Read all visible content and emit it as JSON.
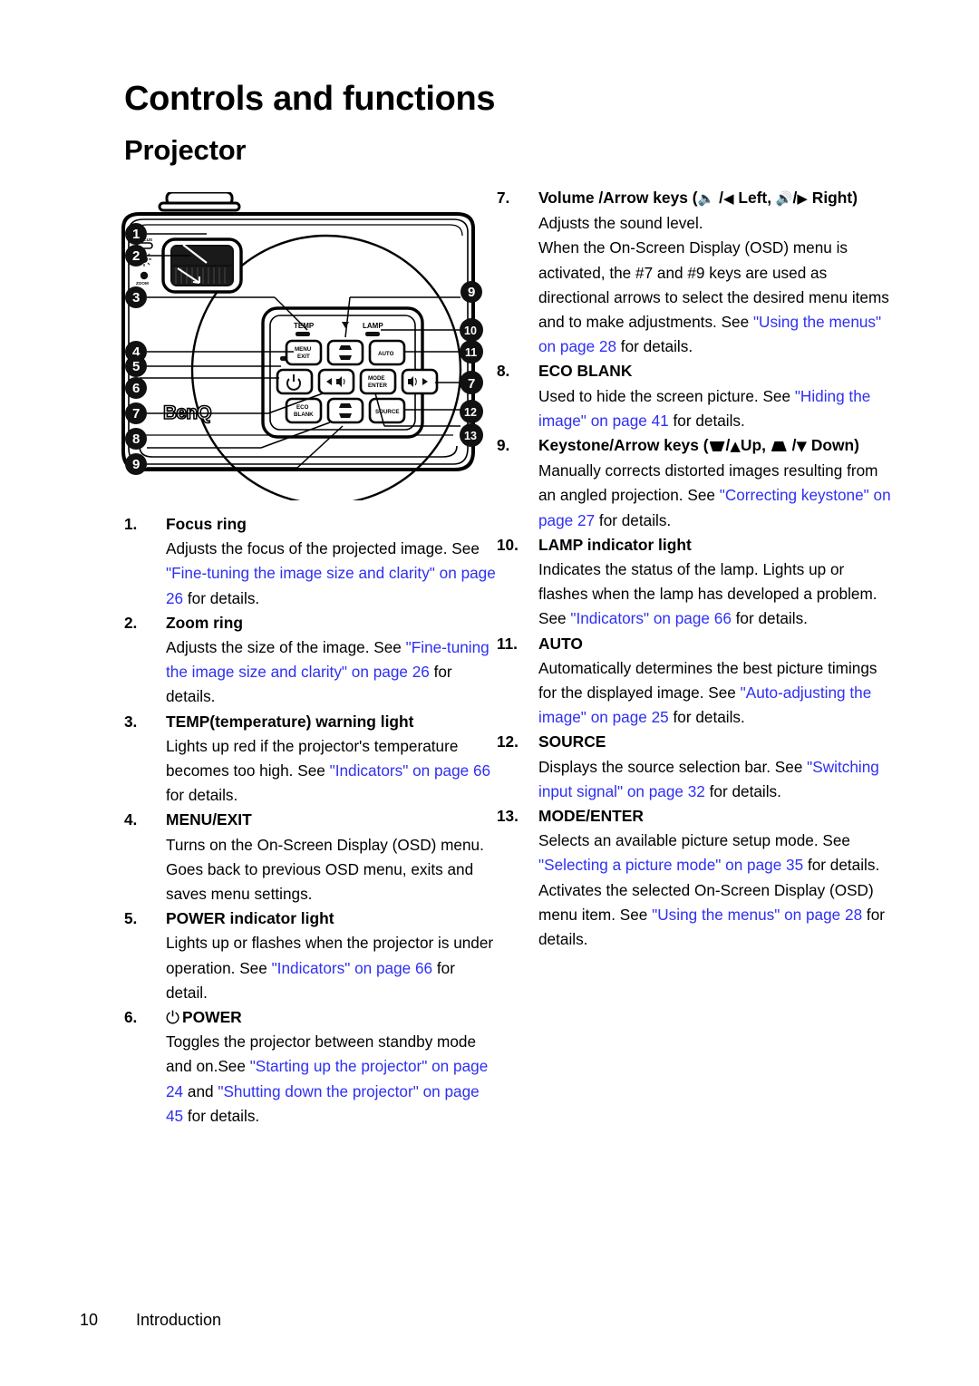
{
  "document": {
    "h1": "Controls and functions",
    "h2": "Projector"
  },
  "footer": {
    "page_number": "10",
    "section": "Introduction"
  },
  "figure": {
    "name": "projector-top-view-diagram",
    "brand_logo": "BenQ",
    "lens_labels": {
      "focus": "FOCUS",
      "zoom": "ZOOM"
    },
    "panel_indicator_labels": {
      "temp": "TEMP",
      "lamp": "LAMP"
    },
    "buttons": [
      {
        "id": "menu-exit",
        "line1": "MENU",
        "line2": "EXIT"
      },
      {
        "id": "keystone-up",
        "line1": "",
        "line2": ""
      },
      {
        "id": "auto",
        "line1": "AUTO",
        "line2": ""
      },
      {
        "id": "power",
        "line1": "",
        "line2": ""
      },
      {
        "id": "volume-left",
        "line1": "",
        "line2": ""
      },
      {
        "id": "mode-enter",
        "line1": "MODE",
        "line2": "ENTER"
      },
      {
        "id": "volume-right",
        "line1": "",
        "line2": ""
      },
      {
        "id": "eco-blank",
        "line1": "ECO",
        "line2": "BLANK"
      },
      {
        "id": "keystone-down",
        "line1": "",
        "line2": ""
      },
      {
        "id": "source",
        "line1": "SOURCE",
        "line2": ""
      }
    ],
    "callouts_left": [
      "1",
      "2",
      "3",
      "4",
      "5",
      "6",
      "7",
      "8",
      "9"
    ],
    "callouts_right": [
      "9",
      "10",
      "11",
      "7",
      "12",
      "13"
    ]
  },
  "left_column": [
    {
      "number": "1.",
      "term": "Focus ring",
      "lines": [
        [
          {
            "t": "Adjusts the focus of the projected image. ",
            "link": false
          },
          {
            "t": "See ",
            "link": false
          },
          {
            "t": "\"Fine-tuning the image size and clarity\" on page 26",
            "link": true
          },
          {
            "t": " for details.",
            "link": false
          }
        ]
      ]
    },
    {
      "number": "2.",
      "term": "Zoom ring",
      "lines": [
        [
          {
            "t": "Adjusts the size of the image. See ",
            "link": false
          },
          {
            "t": "\"Fine-tuning the image size and clarity\" on page 26",
            "link": true
          },
          {
            "t": " for details.",
            "link": false
          }
        ]
      ]
    },
    {
      "number": "3.",
      "term": "TEMP(temperature) warning light",
      "lines": [
        [
          {
            "t": "Lights up red if the projector's temperature becomes too high. See ",
            "link": false
          },
          {
            "t": "\"Indicators\" on page 66",
            "link": true
          },
          {
            "t": " for details.",
            "link": false
          }
        ]
      ]
    },
    {
      "number": "4.",
      "term": "MENU/EXIT",
      "lines": [
        [
          {
            "t": "Turns on the On-Screen Display (OSD) menu. Goes back to previous OSD menu, exits and saves menu settings.",
            "link": false
          }
        ]
      ]
    },
    {
      "number": "5.",
      "term": "POWER indicator light",
      "lines": [
        [
          {
            "t": "Lights up or flashes when the projector is under operation. See ",
            "link": false
          },
          {
            "t": "\"Indicators\" on page 66",
            "link": true
          },
          {
            "t": " for detail.",
            "link": false
          }
        ]
      ]
    },
    {
      "number": "6.",
      "term": "POWER",
      "term_glyph": "⏻",
      "lines": [
        [
          {
            "t": "Toggles the projector between standby mode and on.See ",
            "link": false
          },
          {
            "t": "\"Starting up the projector\" on page 24",
            "link": true
          },
          {
            "t": " and ",
            "link": false
          },
          {
            "t": "\"Shutting down the projector\" on page 45",
            "link": true
          },
          {
            "t": " for details.",
            "link": false
          }
        ]
      ]
    }
  ],
  "right_column": [
    {
      "number": "7.",
      "term_parts": [
        {
          "t": "Volume /Arrow keys (",
          "kind": "text"
        },
        {
          "t": "speaker-low-icon",
          "kind": "glyph",
          "ch": "🔈"
        },
        {
          "t": " /",
          "kind": "text"
        },
        {
          "t": "left-arrow-icon",
          "kind": "glyph",
          "ch": "◀"
        },
        {
          "t": "  Left, ",
          "kind": "text"
        },
        {
          "t": "speaker-high-icon",
          "kind": "glyph",
          "ch": "🔊"
        },
        {
          "t": "/",
          "kind": "text"
        },
        {
          "t": "right-arrow-icon",
          "kind": "glyph",
          "ch": "▶"
        },
        {
          "t": "  Right)",
          "kind": "text"
        }
      ],
      "term_plain": "Volume /Arrow keys ( / Left, / Right)",
      "lines": [
        [
          {
            "t": "Adjusts the sound level.",
            "link": false
          }
        ],
        [
          {
            "t": "When the On-Screen Display (OSD) menu is activated, the #7 and #9 keys are used as directional arrows to select the desired menu items and to make adjustments. See ",
            "link": false
          },
          {
            "t": "\"Using the menus\" on page 28",
            "link": true
          },
          {
            "t": " for details.",
            "link": false
          }
        ]
      ]
    },
    {
      "number": "8.",
      "term": "ECO BLANK",
      "lines": [
        [
          {
            "t": "Used to hide the screen picture. See ",
            "link": false
          },
          {
            "t": "\"Hiding the image\" on page 41",
            "link": true
          },
          {
            "t": " for details.",
            "link": false
          }
        ]
      ]
    },
    {
      "number": "9.",
      "term_parts": [
        {
          "t": "Keystone/Arrow keys (",
          "kind": "text"
        },
        {
          "t": "keystone-down-icon",
          "kind": "keystone",
          "dir": "down"
        },
        {
          "t": "/",
          "kind": "text"
        },
        {
          "t": "up-arrow-icon",
          "kind": "glyph",
          "ch": "▲"
        },
        {
          "t": "Up, ",
          "kind": "text"
        },
        {
          "t": "keystone-up-icon",
          "kind": "keystone",
          "dir": "up"
        },
        {
          "t": " /",
          "kind": "text"
        },
        {
          "t": "down-arrow-icon",
          "kind": "glyph",
          "ch": "▼"
        },
        {
          "t": " Down)",
          "kind": "text"
        }
      ],
      "term_plain": "Keystone/Arrow keys ( /Up, / Down)",
      "lines": [
        [
          {
            "t": "Manually corrects distorted images resulting from an angled projection. See ",
            "link": false
          },
          {
            "t": "\"Correcting keystone\" on page 27",
            "link": true
          },
          {
            "t": " for details.",
            "link": false
          }
        ]
      ]
    },
    {
      "number": "10.",
      "term": "LAMP indicator light",
      "lines": [
        [
          {
            "t": "Indicates the status of the lamp. Lights up or flashes when the lamp has developed a problem. See ",
            "link": false
          },
          {
            "t": "\"Indicators\" on page 66",
            "link": true
          },
          {
            "t": " for details.",
            "link": false
          }
        ]
      ]
    },
    {
      "number": "11.",
      "term": "AUTO",
      "lines": [
        [
          {
            "t": "Automatically determines the best picture timings for the displayed image. See ",
            "link": false
          },
          {
            "t": "\"Auto-adjusting the image\" on page 25",
            "link": true
          },
          {
            "t": " for details.",
            "link": false
          }
        ]
      ]
    },
    {
      "number": "12.",
      "term": "SOURCE",
      "lines": [
        [
          {
            "t": "Displays the source selection bar. See ",
            "link": false
          },
          {
            "t": "\"Switching input signal\" on page 32",
            "link": true
          },
          {
            "t": " for details.",
            "link": false
          }
        ]
      ]
    },
    {
      "number": "13.",
      "term": "MODE/ENTER",
      "lines": [
        [
          {
            "t": "Selects an available picture setup mode. See ",
            "link": false
          },
          {
            "t": "\"Selecting a picture mode\" on page 35",
            "link": true
          },
          {
            "t": " for details.",
            "link": false
          }
        ],
        [
          {
            "t": "Activates the selected On-Screen Display (OSD) menu item. See ",
            "link": false
          },
          {
            "t": "\"Using the menus\" on page 28",
            "link": true
          },
          {
            "t": " for details.",
            "link": false
          }
        ]
      ]
    }
  ],
  "colors": {
    "link": "#2f30f2",
    "text": "#000000",
    "background": "#ffffff"
  }
}
